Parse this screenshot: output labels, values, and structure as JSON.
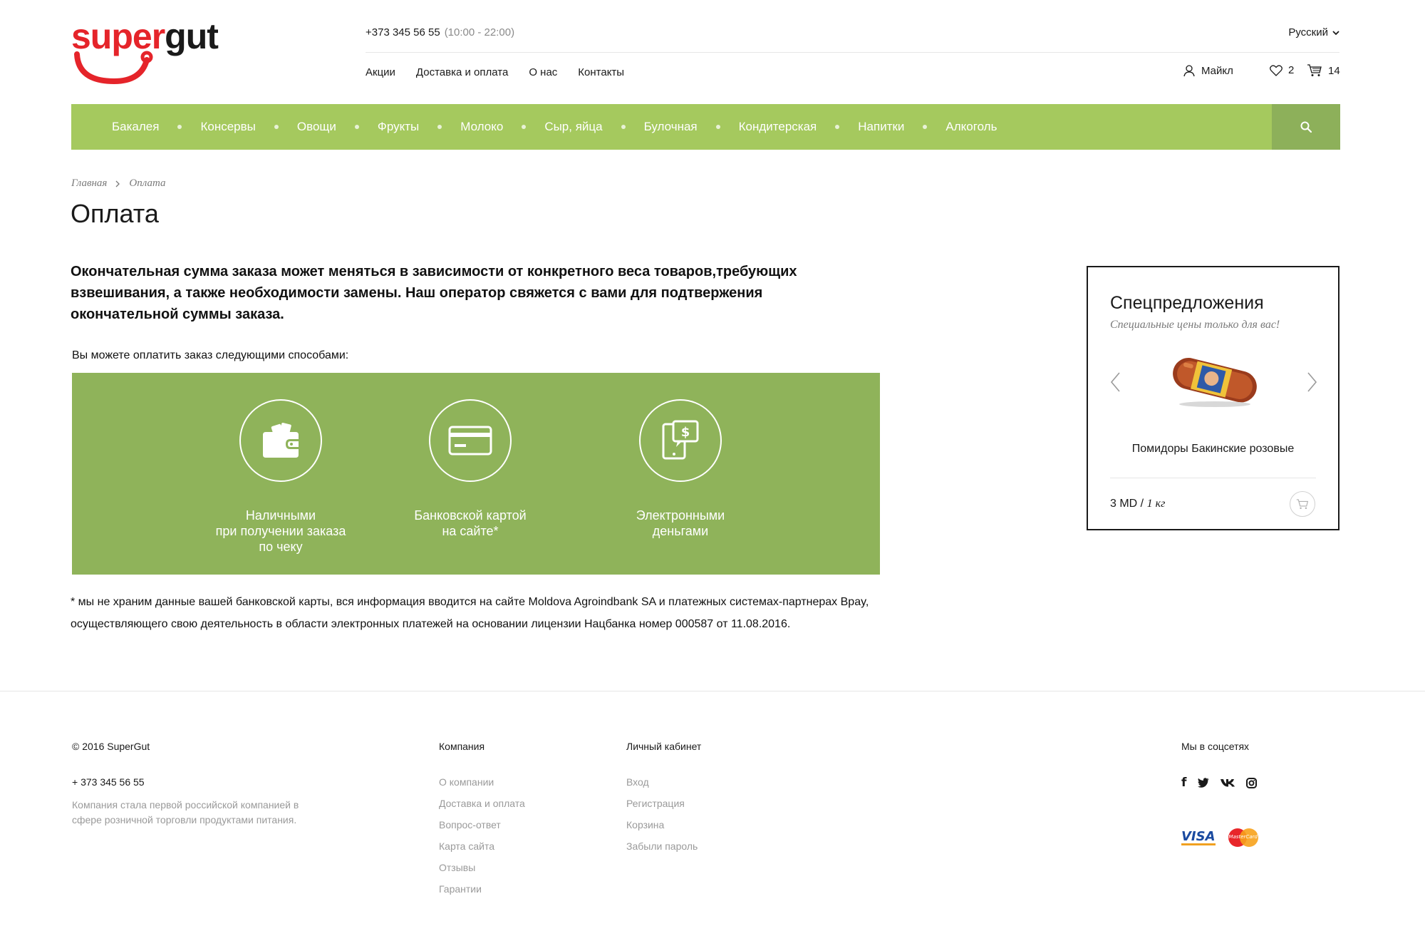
{
  "brand": {
    "logo_part1": "super",
    "logo_part2": "gut",
    "accent": "#e5242a"
  },
  "header": {
    "phone": "+373 345 56 55",
    "hours": "(10:00 - 22:00)",
    "language": "Русский",
    "nav": [
      "Акции",
      "Доставка и оплата",
      "О нас",
      "Контакты"
    ],
    "user_name": "Майкл",
    "favorites_count": "2",
    "cart_count": "14"
  },
  "categories": [
    "Бакалея",
    "Консервы",
    "Овощи",
    "Фрукты",
    "Молоко",
    "Сыр, яйца",
    "Булочная",
    "Кондитерская",
    "Напитки",
    "Алкоголь"
  ],
  "colors": {
    "category_bar": "#a5c95e",
    "search_button": "#8db05a",
    "payment_panel": "#8fb35a"
  },
  "breadcrumb": {
    "home": "Главная",
    "current": "Оплата"
  },
  "page": {
    "title": "Оплата",
    "intro": "Окончательная сумма заказа может меняться в зависимости от конкретного веса товаров,требующих взвешивания, а также необходимости замены.   Наш оператор свяжется с вами для подтвержения окончательной суммы заказа.",
    "methods_label": "Вы можете оплатить заказ следующими способами:",
    "methods": [
      {
        "icon": "wallet-icon",
        "label": "Наличными\nпри получении заказа\nпо чеку"
      },
      {
        "icon": "credit-card-icon",
        "label": "Банковской картой\nна сайте*"
      },
      {
        "icon": "mobile-payment-icon",
        "label": "Электронными\nденьгами"
      }
    ],
    "note": "* мы не храним данные вашей банковской карты, вся информация вводится на сайте Moldova Agroindbank SA и  платежных системах-партнерах Bpay, осуществляющего свою деятельность в области электронных платежей на основании лицензии Нацбанка номер 000587 от 11.08.2016."
  },
  "special_offer": {
    "title": "Спецпредложения",
    "subtitle": "Специальные цены только для вас!",
    "product_name": "Помидоры Бакинские розовые",
    "price": "3 MD",
    "separator": " / ",
    "unit": "1 кг"
  },
  "footer": {
    "copyright": "© 2016 SuperGut",
    "phone": "+ 373 345 56 55",
    "description": "Компания стала первой российской компанией в сфере розничной торговли продуктами питания.",
    "company_title": "Компания",
    "company_links": [
      "О компании",
      "Доставка и оплата",
      "Вопрос-ответ",
      "Карта сайта",
      "Отзывы",
      "Гарантии"
    ],
    "account_title": "Личный кабинет",
    "account_links": [
      "Вход",
      "Регистрация",
      "Корзина",
      "Забыли пароль"
    ],
    "social_title": "Мы в соцсетях",
    "visa": "VISA",
    "mastercard": "MasterCard"
  }
}
